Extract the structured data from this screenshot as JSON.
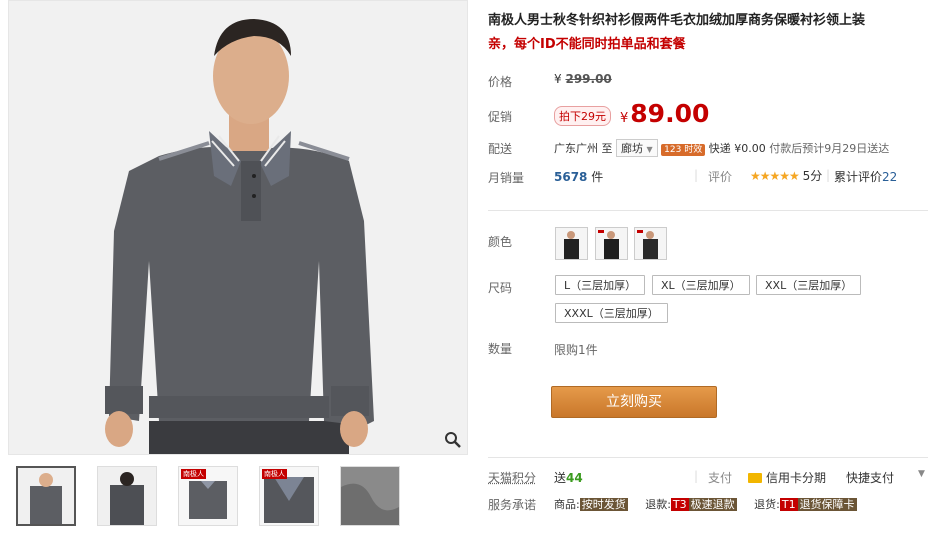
{
  "product": {
    "title": "南极人男士秋冬针织衬衫假两件毛衣加绒加厚商务保暖衬衫领上装",
    "subtitle": "亲，每个ID不能同时拍单品和套餐"
  },
  "price": {
    "label": "价格",
    "original_symbol": "¥",
    "original": "299.00",
    "promo_label": "促销",
    "promo_tag": "拍下29元",
    "symbol": "¥",
    "current": "89.00"
  },
  "shipping": {
    "label": "配送",
    "from": "广东广州",
    "to_word": "至",
    "destination": "廊坊",
    "time_badge": "123 时效",
    "express": "快递 ¥0.00",
    "eta": "付款后预计9月29日送达"
  },
  "stats": {
    "monthly_label": "月销量",
    "monthly_value": "5678",
    "monthly_unit": "件",
    "rating_label": "评价",
    "stars": "★★★★★",
    "score": "5分",
    "reviews_text": "累计评价",
    "reviews_count": "22"
  },
  "options": {
    "color_label": "颜色",
    "size_label": "尺码",
    "sizes": [
      "L（三层加厚）",
      "XL（三层加厚）",
      "XXL（三层加厚）",
      "XXXL（三层加厚）"
    ],
    "quantity_label": "数量",
    "quantity_limit": "限购1件"
  },
  "buy_button": "立刻购买",
  "tmall": {
    "points_label": "天猫积分",
    "points_prefix": "送",
    "points_value": "44",
    "pay_label": "支付",
    "credit_installment": "信用卡分期",
    "quick_pay": "快捷支付"
  },
  "service": {
    "label": "服务承诺",
    "goods_label": "商品:",
    "goods_tag": "按时发货",
    "refund_label": "退款:",
    "refund_code": "T3",
    "refund_tag": "极速退款",
    "return_label": "退货:",
    "return_code": "T1",
    "return_tag": "退货保障卡"
  },
  "thumb_tags": [
    "",
    "",
    "南极人",
    "南极人",
    ""
  ],
  "colors": {
    "accent_red": "#c40000",
    "buy_orange": "#d6832f",
    "sweater_gray": "#5c5e63"
  }
}
